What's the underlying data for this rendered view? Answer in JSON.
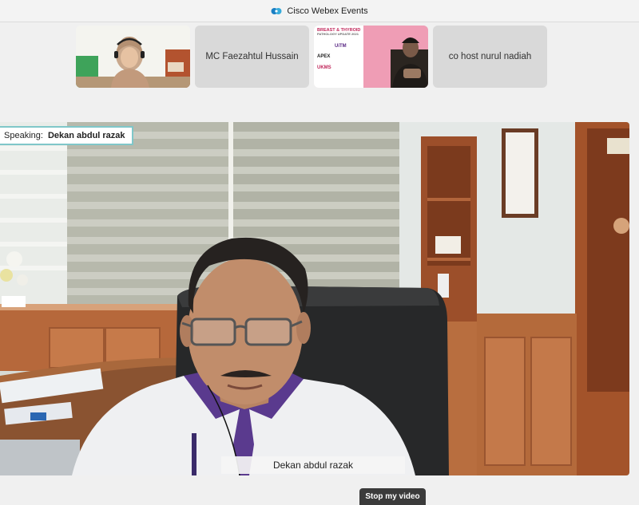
{
  "window": {
    "title": "Cisco Webex Events"
  },
  "participants": [
    {
      "name": "",
      "has_video": true
    },
    {
      "name": "MC Faezahtul Hussain",
      "has_video": false
    },
    {
      "name": "",
      "has_video": true,
      "poster_text": [
        "BREAST & THYROID",
        "PATHOLOGY UPDATE 2021",
        "UiTM",
        "APEX",
        "UKMS"
      ]
    },
    {
      "name": "co host nurul nadiah",
      "has_video": false
    }
  ],
  "main_video": {
    "speaking_label": "Speaking:",
    "speaker_name": "Dekan abdul razak",
    "name_tag": "Dekan abdul razak"
  },
  "controls": {
    "stop_video_label": "Stop my video"
  },
  "colors": {
    "speaking_border": "#7fc7c9",
    "control_bg": "#3b3b3b",
    "tile_bg": "#d9d9d9"
  }
}
